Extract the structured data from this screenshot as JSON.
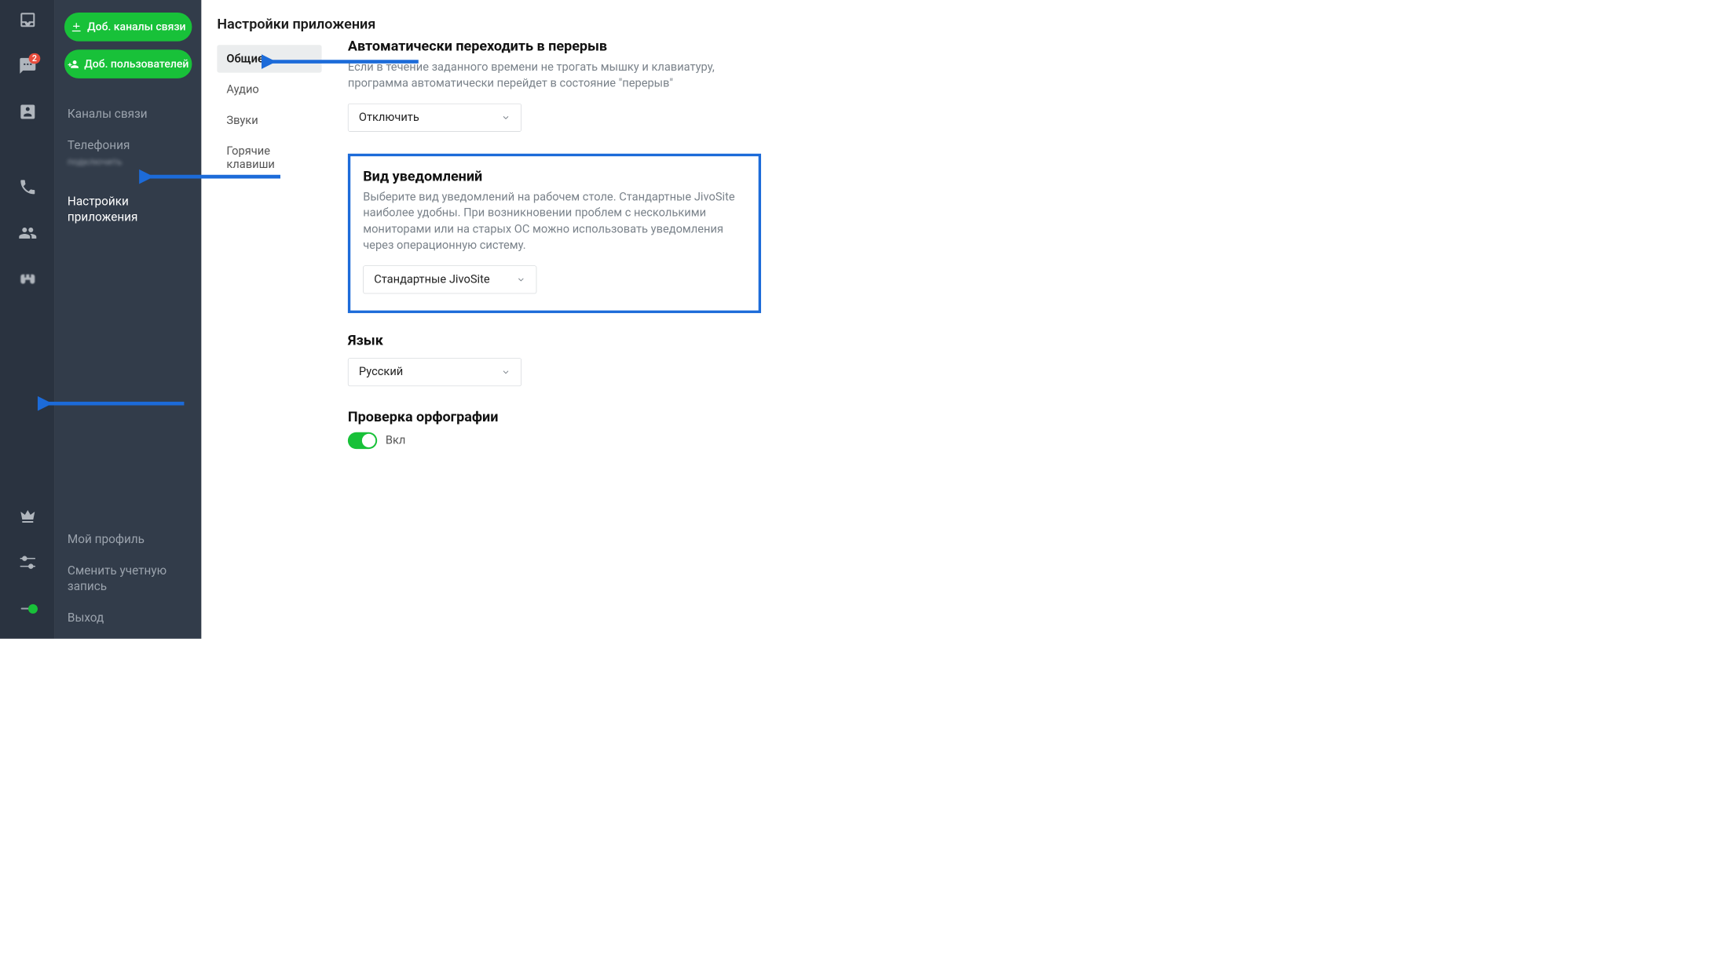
{
  "rail": {
    "badge": "2"
  },
  "sidebar": {
    "btn_channels": "Доб. каналы связи",
    "btn_users": "Доб. пользователей",
    "items": {
      "channels": "Каналы связи",
      "telephony": "Телефония",
      "blurred_extra": "подключить",
      "app_settings": "Настройки приложения",
      "my_profile": "Мой профиль",
      "change_account": "Сменить учетную запись",
      "logout": "Выход"
    }
  },
  "page": {
    "title": "Настройки приложения"
  },
  "tabs": {
    "general": "Общие",
    "audio": "Аудио",
    "sounds": "Звуки",
    "hotkeys": "Горячие клавиши"
  },
  "sections": {
    "auto_break": {
      "title": "Автоматически переходить в перерыв",
      "desc": "Если в течение заданного времени не трогать мышку и клавиатуру, программа автоматически перейдет в состояние \"перерыв\"",
      "value": "Отключить"
    },
    "notifications": {
      "title": "Вид уведомлений",
      "desc": "Выберите вид уведомлений на рабочем столе. Стандартные JivoSite наиболее удобны. При возникновении проблем с несколькими мониторами или на старых ОС можно использовать уведомления через операционную систему.",
      "value": "Стандартные JivoSite"
    },
    "language": {
      "title": "Язык",
      "value": "Русский"
    },
    "spellcheck": {
      "title": "Проверка орфографии",
      "toggle_label": "Вкл"
    }
  }
}
